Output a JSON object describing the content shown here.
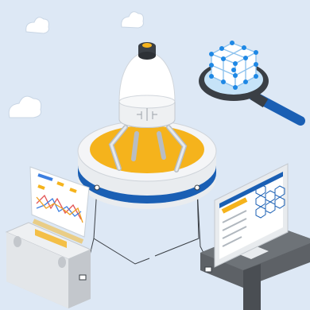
{
  "colors": {
    "background": "#dde8f5",
    "accent_yellow": "#f5b31c",
    "accent_blue": "#1a5fb4",
    "light_blue": "#4a90e2",
    "cube_node": "#1e88e5",
    "platform_white": "#f2f4f6",
    "device_gray": "#d7dadd",
    "dark_gray": "#5d6166",
    "chart_red": "#e25555",
    "chart_blue": "#3d7fe0",
    "chart_orange": "#f0a020"
  },
  "icons": {
    "rocket": "rocket-icon",
    "cube": "cube-network-icon",
    "magnifier": "magnifying-glass-icon",
    "cloud": "cloud-icon",
    "monitor": "monitor-icon",
    "chart_panel": "line-chart-panel-icon",
    "device": "hardware-device-icon",
    "hexagon_mesh": "hexagon-mesh-icon"
  }
}
